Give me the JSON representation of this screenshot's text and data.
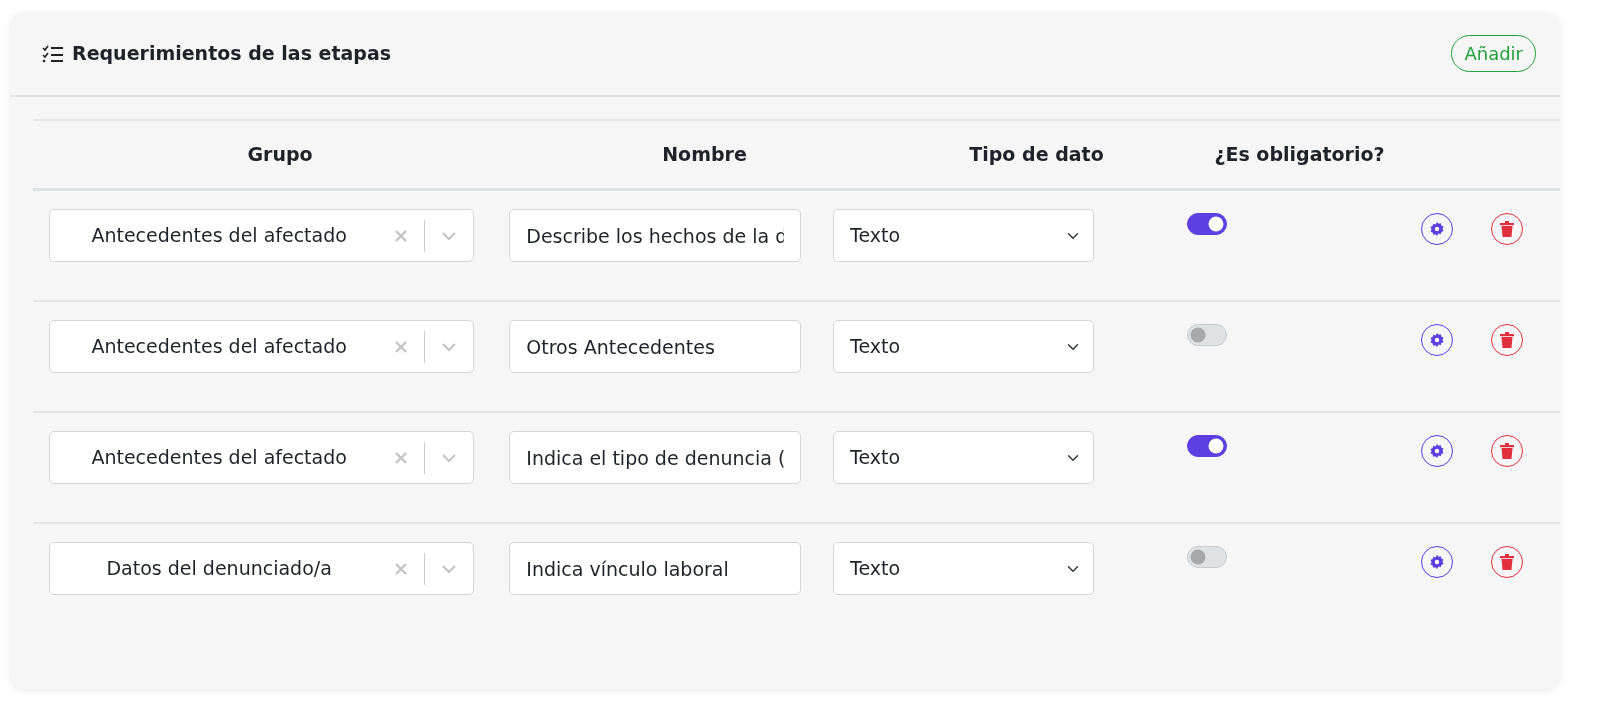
{
  "card": {
    "title": "Requerimientos de las etapas",
    "add_button": "Añadir"
  },
  "table": {
    "columns": [
      "Grupo",
      "Nombre",
      "Tipo de dato",
      "¿Es obligatorio?"
    ],
    "rows": [
      {
        "group": "Antecedentes del afectado",
        "name": "Describe los hechos de la d",
        "type": "Texto",
        "required": true
      },
      {
        "group": "Antecedentes del afectado",
        "name": "Otros Antecedentes",
        "type": "Texto",
        "required": false
      },
      {
        "group": "Antecedentes del afectado",
        "name": "Indica el tipo de denuncia (",
        "type": "Texto",
        "required": true
      },
      {
        "group": "Datos del denunciado/a",
        "name": "Indica vínculo laboral",
        "type": "Texto",
        "required": false
      }
    ]
  }
}
